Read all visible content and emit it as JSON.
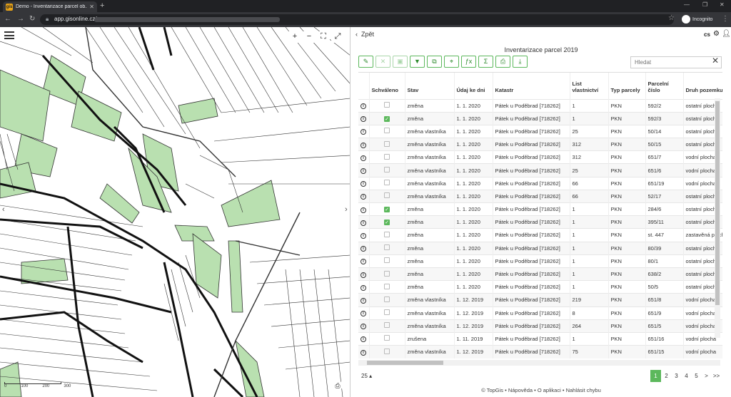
{
  "browser": {
    "tab_title": "Demo - Inventarizace parcel ob...",
    "favicon": "gis",
    "url": "app.gisonline.cz/",
    "incognito_label": "Incognito"
  },
  "panel": {
    "back_label": "Zpět",
    "lang": "cs",
    "title": "Inventarizace parcel 2019",
    "search_placeholder": "Hledat",
    "columns": [
      "",
      "Schváleno",
      "Stav",
      "Údaj ke dni",
      "Katastr",
      "List vlastnictví",
      "Typ parcely",
      "Parcelní číslo",
      "Druh pozemku"
    ],
    "rows": [
      {
        "approved": false,
        "stav": "změna",
        "date": "1. 1. 2020",
        "katastr": "Pátek u Poděbrad [718262]",
        "lv": "1",
        "typ": "PKN",
        "cislo": "592/2",
        "druh": "ostatní plocha"
      },
      {
        "approved": true,
        "stav": "změna",
        "date": "1. 1. 2020",
        "katastr": "Pátek u Poděbrad [718262]",
        "lv": "1",
        "typ": "PKN",
        "cislo": "592/3",
        "druh": "ostatní plocha"
      },
      {
        "approved": false,
        "stav": "změna vlastníka",
        "date": "1. 1. 2020",
        "katastr": "Pátek u Poděbrad [718262]",
        "lv": "25",
        "typ": "PKN",
        "cislo": "50/14",
        "druh": "ostatní plocha"
      },
      {
        "approved": false,
        "stav": "změna vlastníka",
        "date": "1. 1. 2020",
        "katastr": "Pátek u Poděbrad [718262]",
        "lv": "312",
        "typ": "PKN",
        "cislo": "50/15",
        "druh": "ostatní plocha"
      },
      {
        "approved": false,
        "stav": "změna vlastníka",
        "date": "1. 1. 2020",
        "katastr": "Pátek u Poděbrad [718262]",
        "lv": "312",
        "typ": "PKN",
        "cislo": "651/7",
        "druh": "vodní plocha"
      },
      {
        "approved": false,
        "stav": "změna vlastníka",
        "date": "1. 1. 2020",
        "katastr": "Pátek u Poděbrad [718262]",
        "lv": "25",
        "typ": "PKN",
        "cislo": "651/6",
        "druh": "vodní plocha"
      },
      {
        "approved": false,
        "stav": "změna vlastníka",
        "date": "1. 1. 2020",
        "katastr": "Pátek u Poděbrad [718262]",
        "lv": "66",
        "typ": "PKN",
        "cislo": "651/19",
        "druh": "vodní plocha"
      },
      {
        "approved": false,
        "stav": "změna vlastníka",
        "date": "1. 1. 2020",
        "katastr": "Pátek u Poděbrad [718262]",
        "lv": "66",
        "typ": "PKN",
        "cislo": "52/17",
        "druh": "ostatní plocha"
      },
      {
        "approved": true,
        "stav": "změna",
        "date": "1. 1. 2020",
        "katastr": "Pátek u Poděbrad [718262]",
        "lv": "1",
        "typ": "PKN",
        "cislo": "284/6",
        "druh": "ostatní plocha"
      },
      {
        "approved": true,
        "stav": "změna",
        "date": "1. 1. 2020",
        "katastr": "Pátek u Poděbrad [718262]",
        "lv": "1",
        "typ": "PKN",
        "cislo": "395/11",
        "druh": "ostatní plocha"
      },
      {
        "approved": false,
        "stav": "změna",
        "date": "1. 1. 2020",
        "katastr": "Pátek u Poděbrad [718262]",
        "lv": "1",
        "typ": "PKN",
        "cislo": "st. 447",
        "druh": "zastavěná plocha"
      },
      {
        "approved": false,
        "stav": "změna",
        "date": "1. 1. 2020",
        "katastr": "Pátek u Poděbrad [718262]",
        "lv": "1",
        "typ": "PKN",
        "cislo": "80/39",
        "druh": "ostatní plocha"
      },
      {
        "approved": false,
        "stav": "změna",
        "date": "1. 1. 2020",
        "katastr": "Pátek u Poděbrad [718262]",
        "lv": "1",
        "typ": "PKN",
        "cislo": "80/1",
        "druh": "ostatní plocha"
      },
      {
        "approved": false,
        "stav": "změna",
        "date": "1. 1. 2020",
        "katastr": "Pátek u Poděbrad [718262]",
        "lv": "1",
        "typ": "PKN",
        "cislo": "638/2",
        "druh": "ostatní plocha"
      },
      {
        "approved": false,
        "stav": "změna",
        "date": "1. 1. 2020",
        "katastr": "Pátek u Poděbrad [718262]",
        "lv": "1",
        "typ": "PKN",
        "cislo": "50/5",
        "druh": "ostatní plocha"
      },
      {
        "approved": false,
        "stav": "změna vlastníka",
        "date": "1. 12. 2019",
        "katastr": "Pátek u Poděbrad [718262]",
        "lv": "219",
        "typ": "PKN",
        "cislo": "651/8",
        "druh": "vodní plocha"
      },
      {
        "approved": false,
        "stav": "změna vlastníka",
        "date": "1. 12. 2019",
        "katastr": "Pátek u Poděbrad [718262]",
        "lv": "8",
        "typ": "PKN",
        "cislo": "651/9",
        "druh": "vodní plocha"
      },
      {
        "approved": false,
        "stav": "změna vlastníka",
        "date": "1. 12. 2019",
        "katastr": "Pátek u Poděbrad [718262]",
        "lv": "264",
        "typ": "PKN",
        "cislo": "651/5",
        "druh": "vodní plocha"
      },
      {
        "approved": false,
        "stav": "zrušena",
        "date": "1. 11. 2019",
        "katastr": "Pátek u Poděbrad [718262]",
        "lv": "1",
        "typ": "PKN",
        "cislo": "651/16",
        "druh": "vodní plocha"
      },
      {
        "approved": false,
        "stav": "změna vlastníka",
        "date": "1. 12. 2019",
        "katastr": "Pátek u Poděbrad [718262]",
        "lv": "75",
        "typ": "PKN",
        "cislo": "651/15",
        "druh": "vodní plocha"
      }
    ],
    "page_size": "25",
    "pages": [
      "1",
      "2",
      "3",
      "4",
      "5",
      ">",
      ">>"
    ],
    "footer": [
      "© TopGis",
      "Nápověda",
      "O aplikaci",
      "Nahlásit chybu"
    ]
  },
  "map": {
    "scale_labels": [
      "0",
      "100",
      "200",
      "300"
    ]
  },
  "colors": {
    "accent": "#5cb85c",
    "parcel_fill": "#b9e0b0"
  }
}
